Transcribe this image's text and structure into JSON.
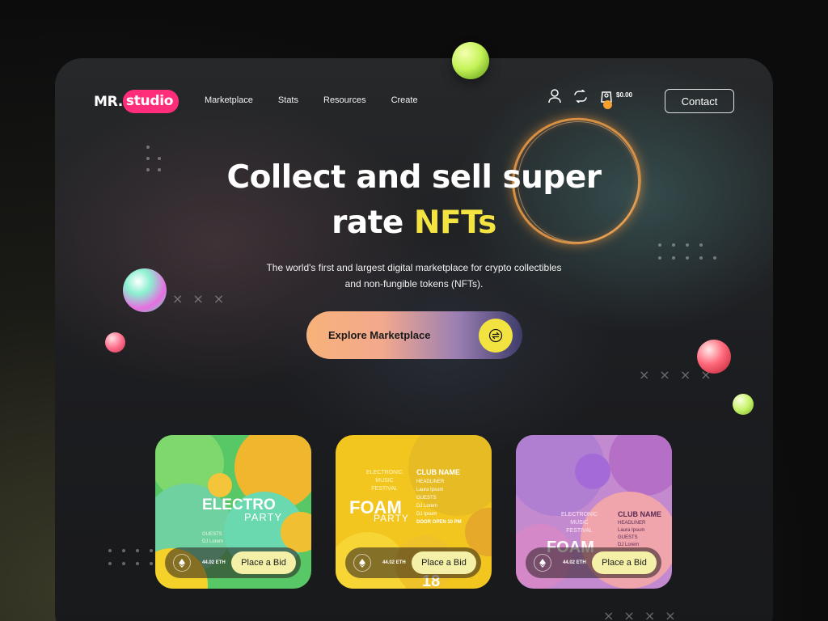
{
  "brand": {
    "name_part1": "MR.",
    "name_part2": "studio",
    "accent_color": "#ff2d7a"
  },
  "nav": {
    "items": [
      {
        "label": "Marketplace"
      },
      {
        "label": "Stats"
      },
      {
        "label": "Resources"
      },
      {
        "label": "Create"
      }
    ]
  },
  "header_icons": {
    "user_icon": "user-icon",
    "swap_icon": "swap-icon",
    "wallet_icon": "wallet-icon"
  },
  "cart": {
    "amount": "$0.00"
  },
  "contact_label": "Contact",
  "hero": {
    "title_line1": "Collect and sell super",
    "title_line2_prefix": "rate ",
    "title_line2_accent": "NFTs",
    "accent_color": "#f4e441",
    "subtitle_line1": "The world's first and largest digital marketplace for crypto collectibles",
    "subtitle_line2": "and non-fungible tokens (NFTs)."
  },
  "cta": {
    "label": "Explore Marketplace",
    "icon": "swap-icon"
  },
  "cards": [
    {
      "title": "ELECTRO",
      "subtitle": "PARTY",
      "extra_lines": [
        "GUESTS",
        "DJ Lorem"
      ],
      "price": "44.02 ETH",
      "bid_label": "Place a Bid"
    },
    {
      "title": "FOAM",
      "subtitle": "PARTY",
      "extra_lines": [
        "ELECTRONIC",
        "MUSIC",
        "FESTIVAL",
        "CLUB NAME",
        "HEADLINER",
        "Laura Ipsum",
        "GUESTS",
        "DJ Lorem",
        "DJ Ipsum",
        "DOOR OPEN 10 PM",
        "18"
      ],
      "price": "44.02 ETH",
      "bid_label": "Place a Bid"
    },
    {
      "title": "FOAM",
      "subtitle": "",
      "extra_lines": [
        "ELECTRONIC",
        "MUSIC",
        "FESTIVAL",
        "CLUB NAME",
        "HEADLINER",
        "Laura Ipsum",
        "GUESTS",
        "DJ Lorem"
      ],
      "price": "44.02 ETH",
      "bid_label": "Place a Bid"
    }
  ]
}
